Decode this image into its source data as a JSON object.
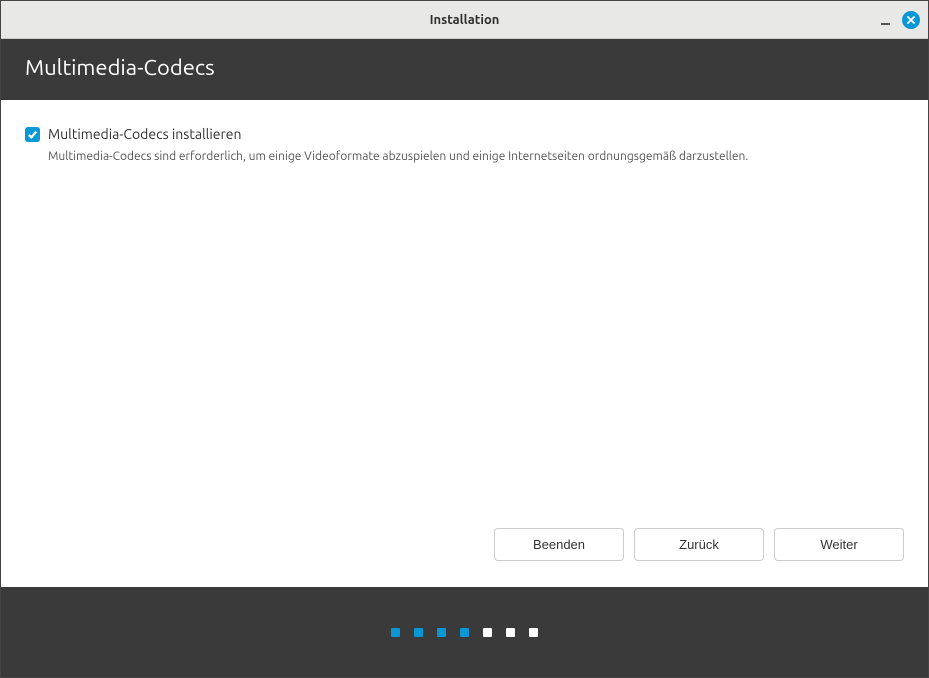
{
  "window": {
    "title": "Installation"
  },
  "header": {
    "title": "Multimedia-Codecs"
  },
  "option": {
    "checked": true,
    "label": "Multimedia-Codecs installieren",
    "description": "Multimedia-Codecs sind erforderlich, um einige Videoformate abzuspielen und einige Internetseiten ordnungsgemäß darzustellen."
  },
  "buttons": {
    "quit": "Beenden",
    "back": "Zurück",
    "next": "Weiter"
  },
  "progress": {
    "total": 7,
    "current": 4
  },
  "colors": {
    "accent": "#0a97d6",
    "header_bg": "#3a3a3a"
  }
}
